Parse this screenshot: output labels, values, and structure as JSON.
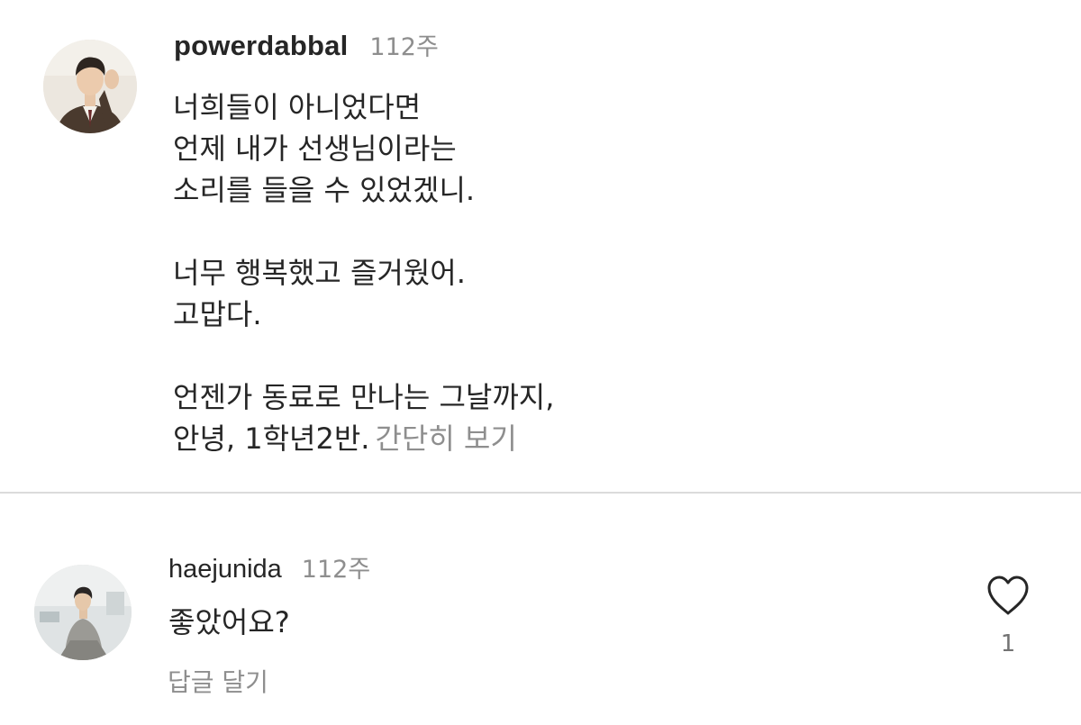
{
  "post_caption": {
    "username": "powerdabbal",
    "time_ago": "112주",
    "text_lines": [
      "너희들이 아니었다면",
      "언제 내가 선생님이라는",
      "소리를 들을 수 있었겠니.",
      "",
      "너무 행복했고 즐거웠어.",
      "고맙다.",
      "",
      "언젠가 동료로 만나는 그날까지,",
      "안녕, 1학년2반."
    ],
    "see_less_label": "간단히 보기",
    "avatar_icon": "profile-photo"
  },
  "reply": {
    "username": "haejunida",
    "time_ago": "112주",
    "text": "좋았어요?",
    "reply_label": "답글 달기",
    "like_icon": "heart-outline-icon",
    "like_count": "1",
    "avatar_icon": "profile-photo"
  },
  "colors": {
    "primary_text": "#262626",
    "secondary_text": "#8e8e8e",
    "divider": "#dbdbdb",
    "background": "#ffffff"
  }
}
